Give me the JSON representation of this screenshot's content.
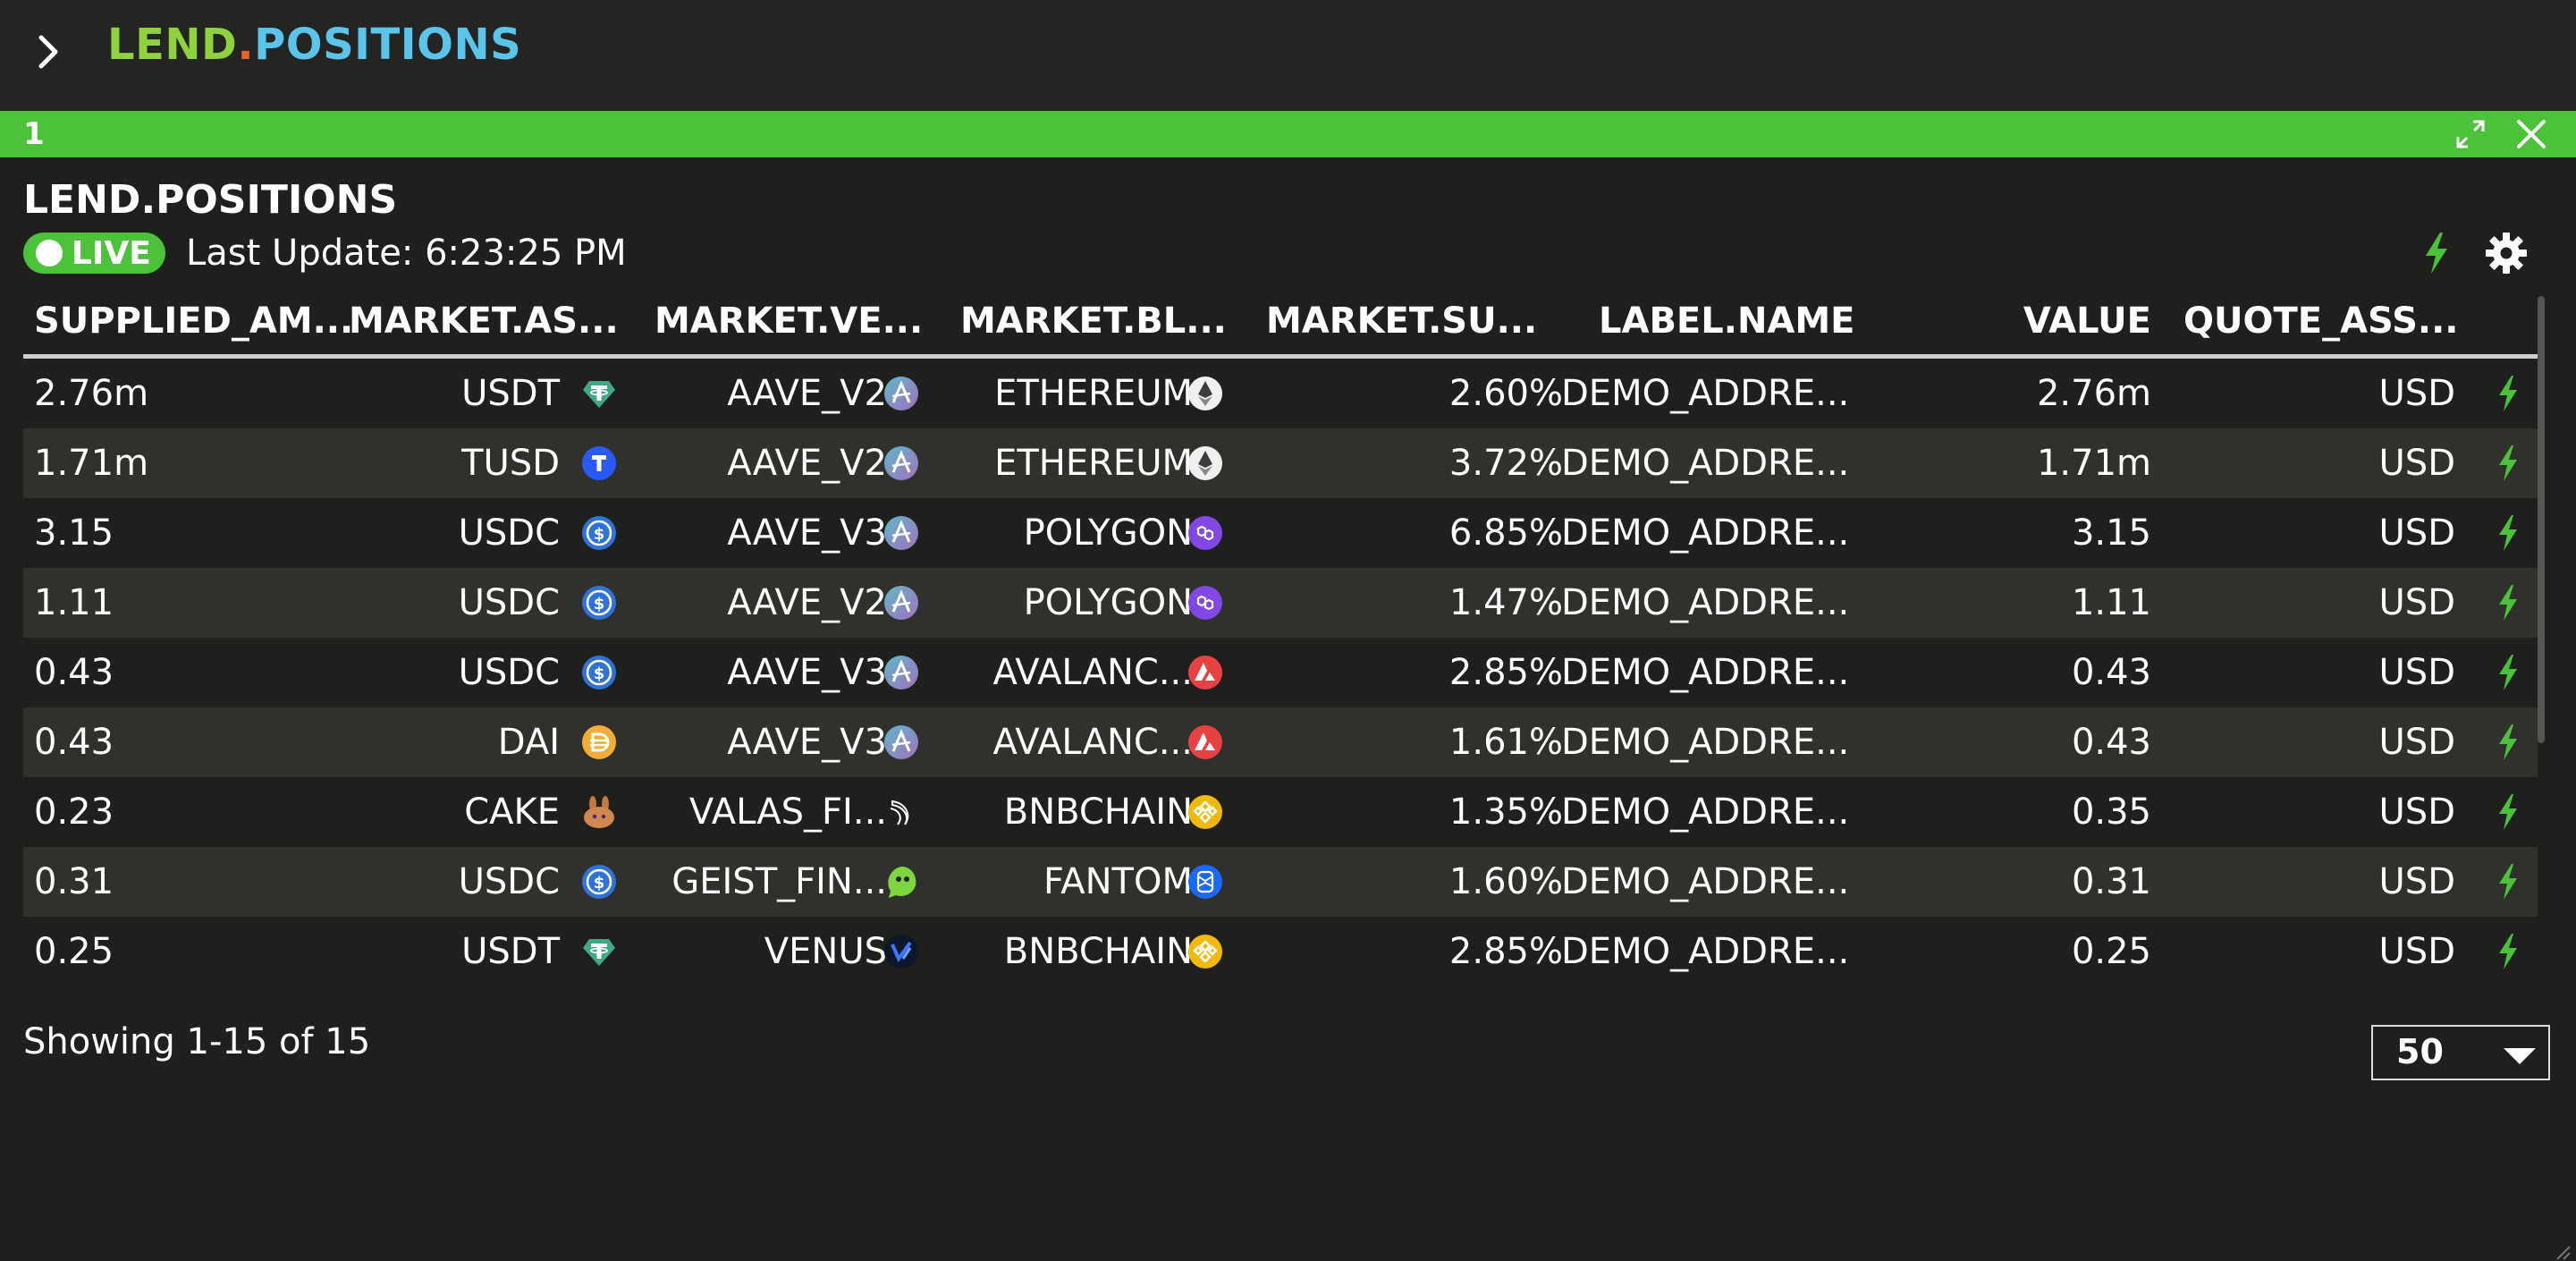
{
  "app": {
    "title_part1": "LEND",
    "title_dot": ".",
    "title_part2": "POSITIONS"
  },
  "window": {
    "number": "1"
  },
  "panel": {
    "title": "LEND.POSITIONS",
    "live_label": "LIVE",
    "last_update": "Last Update: 6:23:25 PM"
  },
  "table": {
    "headers": [
      "SUPPLIED_AM...",
      "MARKET.AS...",
      "MARKET.VE...",
      "MARKET.BL...",
      "MARKET.SU...",
      "LABEL.NAME",
      "VALUE",
      "QUOTE_ASS..."
    ],
    "rows": [
      {
        "supplied": "2.76m",
        "asset": "USDT",
        "venue": "AAVE_V2",
        "chain": "ETHEREUM",
        "rate": "2.60%",
        "label": "DEMO_ADDRE...",
        "value": "2.76m",
        "quote": "USD"
      },
      {
        "supplied": "1.71m",
        "asset": "TUSD",
        "venue": "AAVE_V2",
        "chain": "ETHEREUM",
        "rate": "3.72%",
        "label": "DEMO_ADDRE...",
        "value": "1.71m",
        "quote": "USD"
      },
      {
        "supplied": "3.15",
        "asset": "USDC",
        "venue": "AAVE_V3",
        "chain": "POLYGON",
        "rate": "6.85%",
        "label": "DEMO_ADDRE...",
        "value": "3.15",
        "quote": "USD"
      },
      {
        "supplied": "1.11",
        "asset": "USDC",
        "venue": "AAVE_V2",
        "chain": "POLYGON",
        "rate": "1.47%",
        "label": "DEMO_ADDRE...",
        "value": "1.11",
        "quote": "USD"
      },
      {
        "supplied": "0.43",
        "asset": "USDC",
        "venue": "AAVE_V3",
        "chain": "AVALANC...",
        "rate": "2.85%",
        "label": "DEMO_ADDRE...",
        "value": "0.43",
        "quote": "USD"
      },
      {
        "supplied": "0.43",
        "asset": "DAI",
        "venue": "AAVE_V3",
        "chain": "AVALANC...",
        "rate": "1.61%",
        "label": "DEMO_ADDRE...",
        "value": "0.43",
        "quote": "USD"
      },
      {
        "supplied": "0.23",
        "asset": "CAKE",
        "venue": "VALAS_FI...",
        "chain": "BNBCHAIN",
        "rate": "1.35%",
        "label": "DEMO_ADDRE...",
        "value": "0.35",
        "quote": "USD"
      },
      {
        "supplied": "0.31",
        "asset": "USDC",
        "venue": "GEIST_FIN...",
        "chain": "FANTOM",
        "rate": "1.60%",
        "label": "DEMO_ADDRE...",
        "value": "0.31",
        "quote": "USD"
      },
      {
        "supplied": "0.25",
        "asset": "USDT",
        "venue": "VENUS",
        "chain": "BNBCHAIN",
        "rate": "2.85%",
        "label": "DEMO_ADDRE...",
        "value": "0.25",
        "quote": "USD"
      }
    ]
  },
  "footer": {
    "showing": "Showing 1-15 of 15",
    "page_size": "50"
  },
  "colors": {
    "live_green": "#4cc23a",
    "bolt_green": "#4cc23a",
    "row_alt": "#30302d",
    "background": "#1f1f1d"
  },
  "icons": {
    "USDT": "tether-icon",
    "TUSD": "trueusd-icon",
    "USDC": "usdc-icon",
    "DAI": "dai-icon",
    "CAKE": "pancakeswap-icon",
    "AAVE_V2": "aave-icon",
    "AAVE_V3": "aave-icon",
    "VALAS_FI...": "valas-icon",
    "GEIST_FIN...": "geist-icon",
    "VENUS": "venus-icon",
    "ETHEREUM": "ethereum-icon",
    "POLYGON": "polygon-icon",
    "AVALANC...": "avalanche-icon",
    "BNBCHAIN": "bnbchain-icon",
    "FANTOM": "fantom-icon"
  }
}
